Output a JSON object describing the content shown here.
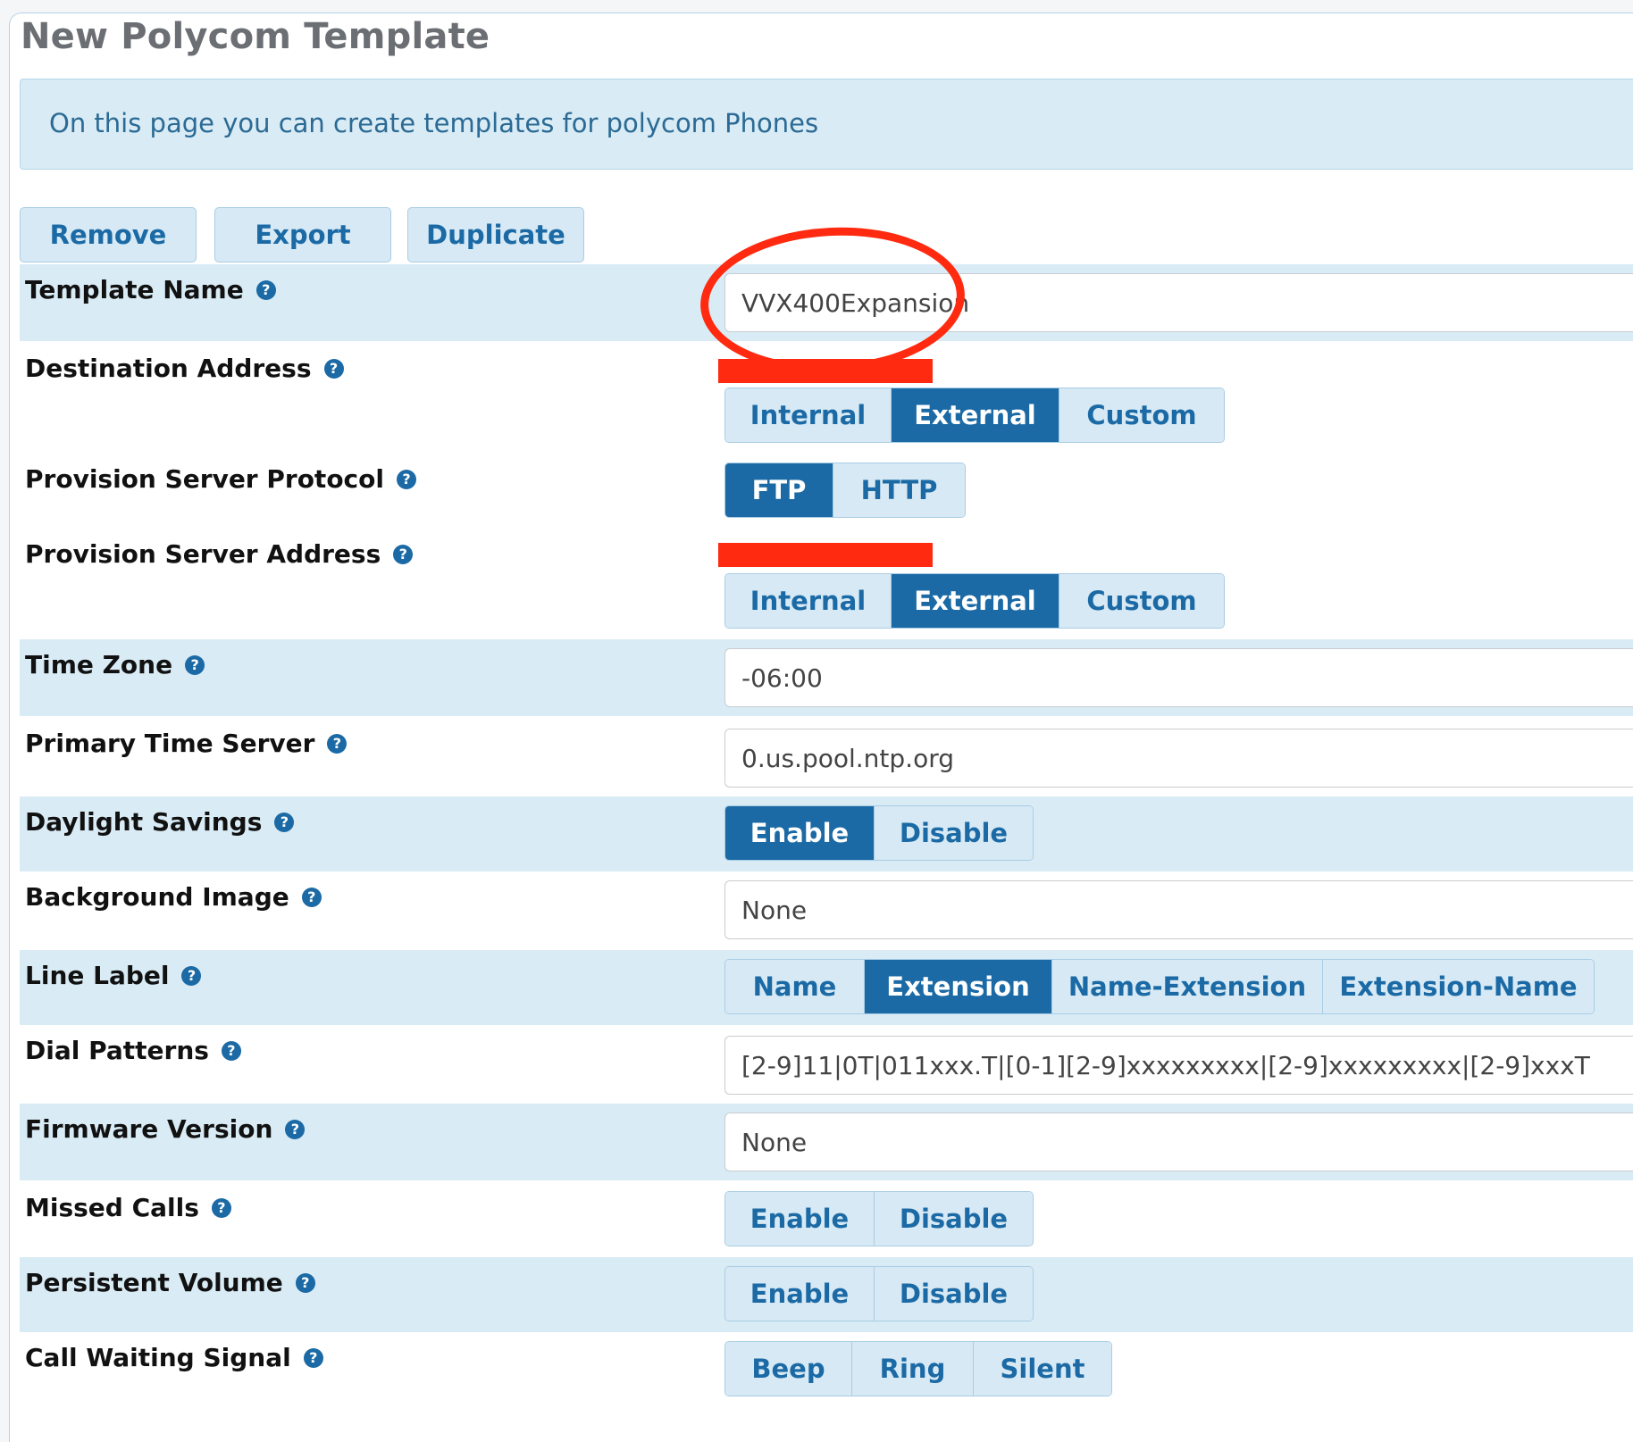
{
  "page": {
    "title": "New Polycom Template",
    "info_text": "On this page you can create templates for polycom Phones"
  },
  "actions": {
    "remove": "Remove",
    "export": "Export",
    "duplicate": "Duplicate"
  },
  "form": {
    "template_name": {
      "label": "Template Name",
      "value": "VVX400Expansion"
    },
    "destination_address": {
      "label": "Destination Address",
      "options": [
        "Internal",
        "External",
        "Custom"
      ],
      "selected": "External"
    },
    "provision_server_protocol": {
      "label": "Provision Server Protocol",
      "options": [
        "FTP",
        "HTTP"
      ],
      "selected": "FTP"
    },
    "provision_server_address": {
      "label": "Provision Server Address",
      "options": [
        "Internal",
        "External",
        "Custom"
      ],
      "selected": "External"
    },
    "time_zone": {
      "label": "Time Zone",
      "value": "-06:00"
    },
    "primary_time_server": {
      "label": "Primary Time Server",
      "value": "0.us.pool.ntp.org"
    },
    "daylight_savings": {
      "label": "Daylight Savings",
      "options": [
        "Enable",
        "Disable"
      ],
      "selected": "Enable"
    },
    "background_image": {
      "label": "Background Image",
      "value": "None"
    },
    "line_label": {
      "label": "Line Label",
      "options": [
        "Name",
        "Extension",
        "Name-Extension",
        "Extension-Name"
      ],
      "selected": "Extension"
    },
    "dial_patterns": {
      "label": "Dial Patterns",
      "value": "[2-9]11|0T|011xxx.T|[0-1][2-9]xxxxxxxxx|[2-9]xxxxxxxxx|[2-9]xxxT"
    },
    "firmware_version": {
      "label": "Firmware Version",
      "value": "None"
    },
    "missed_calls": {
      "label": "Missed Calls",
      "options": [
        "Enable",
        "Disable"
      ],
      "selected": ""
    },
    "persistent_volume": {
      "label": "Persistent Volume",
      "options": [
        "Enable",
        "Disable"
      ],
      "selected": ""
    },
    "call_waiting_signal": {
      "label": "Call Waiting Signal",
      "options": [
        "Beep",
        "Ring",
        "Silent"
      ],
      "selected": ""
    }
  },
  "help_icon": "question-circle-icon",
  "colors": {
    "accent": "#1b6aa5",
    "band": "#d9ebf5",
    "annotation_red": "#ff2a0f"
  }
}
